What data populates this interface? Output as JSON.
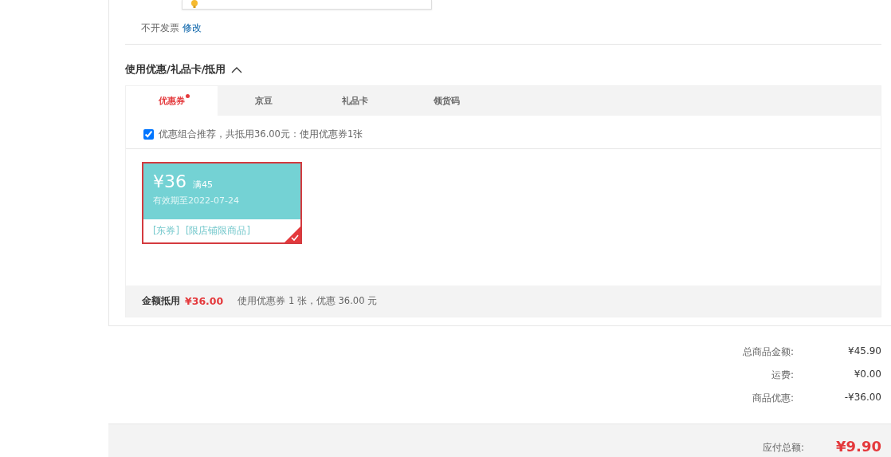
{
  "invoice": {
    "value": "不开发票",
    "edit_link": "修改"
  },
  "discount_section": {
    "title": "使用优惠/礼品卡/抵用",
    "expanded": true,
    "tabs": [
      {
        "label": "优惠券",
        "selected": true,
        "dot": true
      },
      {
        "label": "京豆",
        "selected": false,
        "dot": false
      },
      {
        "label": "礼品卡",
        "selected": false,
        "dot": false
      },
      {
        "label": "领货码",
        "selected": false,
        "dot": false
      }
    ],
    "recommend": {
      "checked": true,
      "text": "优惠组合推荐，共抵用36.00元：使用优惠券1张"
    },
    "coupons": [
      {
        "amount": "¥36",
        "condition": "满45",
        "expiry": "有效期至2022-07-24",
        "tags": [
          "[东券]",
          "[限店铺限商品]"
        ],
        "selected": true
      }
    ],
    "footer": {
      "label": "金额抵用",
      "amount": "¥36.00",
      "note": "使用优惠券 1 张，优惠 36.00 元"
    }
  },
  "summary": [
    {
      "label": "总商品金额:",
      "value": "¥45.90"
    },
    {
      "label": "运费:",
      "value": "¥0.00"
    },
    {
      "label": "商品优惠:",
      "value": "-¥36.00"
    }
  ],
  "total": {
    "label": "应付总额:",
    "value": "¥9.90"
  }
}
